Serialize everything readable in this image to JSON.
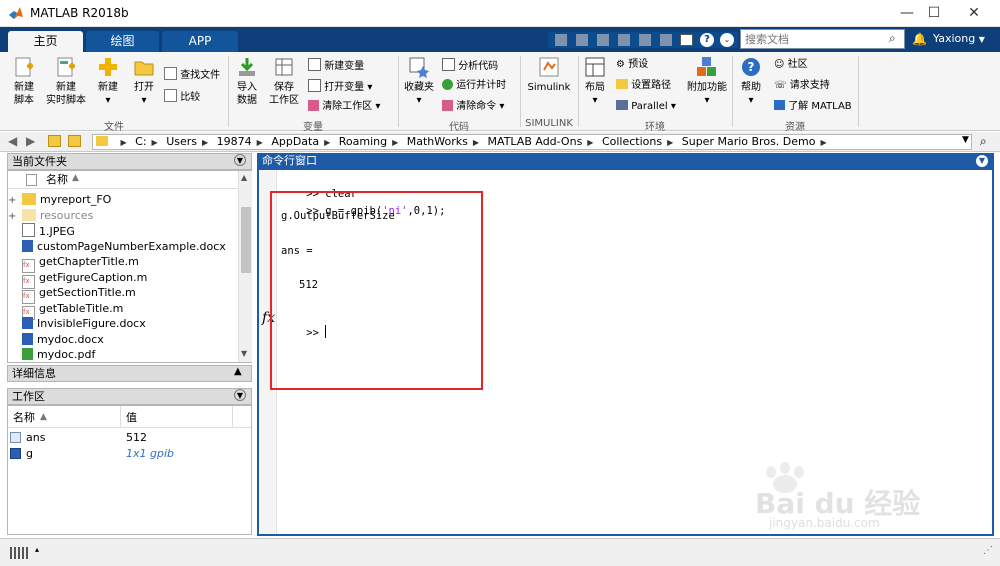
{
  "window": {
    "title": "MATLAB R2018b",
    "controls": [
      "—",
      "☐",
      "✕"
    ]
  },
  "tabs": [
    {
      "label": "主页"
    },
    {
      "label": "绘图"
    },
    {
      "label": "APP"
    }
  ],
  "search": {
    "placeholder": "搜索文档",
    "user": "Yaxiong"
  },
  "ribbon": {
    "file": {
      "new_script": [
        "新建",
        "脚本"
      ],
      "new_live_script": [
        "新建",
        "实时脚本"
      ],
      "new": "新建",
      "open": "打开",
      "find_files": "查找文件",
      "compare": "比较",
      "group_label": "文件"
    },
    "variable": {
      "import": [
        "导入",
        "数据"
      ],
      "save_ws": [
        "保存",
        "工作区"
      ],
      "new_var": "新建变量",
      "open_var": "打开变量",
      "clear_ws": "清除工作区",
      "group_label": "变量"
    },
    "code": {
      "favorites": "收藏夹",
      "analyze": "分析代码",
      "run_time": "运行并计时",
      "clear_cmds": "清除命令",
      "group_label": "代码"
    },
    "simulink": {
      "label": "Simulink",
      "group_label": "SIMULINK"
    },
    "environment": {
      "layout": "布局",
      "preferences": "预设",
      "set_path": "设置路径",
      "parallel": "Parallel",
      "addons": "附加功能",
      "group_label": "环境"
    },
    "resources": {
      "help": "帮助",
      "community": "社区",
      "request_support": "请求支持",
      "learn_matlab": "了解 MATLAB",
      "group_label": "资源"
    }
  },
  "path": [
    "C:",
    "Users",
    "19874",
    "AppData",
    "Roaming",
    "MathWorks",
    "MATLAB Add-Ons",
    "Collections",
    "Super Mario Bros. Demo"
  ],
  "current_folder": {
    "title": "当前文件夹",
    "name_col": "名称",
    "files": [
      {
        "name": "myreport_FO",
        "kind": "folder",
        "expand": "+"
      },
      {
        "name": "resources",
        "kind": "folder-gray",
        "expand": "+"
      },
      {
        "name": "1.JPEG",
        "kind": "file"
      },
      {
        "name": "customPageNumberExample.docx",
        "kind": "docx"
      },
      {
        "name": "getChapterTitle.m",
        "kind": "mfile"
      },
      {
        "name": "getFigureCaption.m",
        "kind": "mfile"
      },
      {
        "name": "getSectionTitle.m",
        "kind": "mfile"
      },
      {
        "name": "getTableTitle.m",
        "kind": "mfile"
      },
      {
        "name": "InvisibleFigure.docx",
        "kind": "docx"
      },
      {
        "name": "mydoc.docx",
        "kind": "docx"
      },
      {
        "name": "mydoc.pdf",
        "kind": "pdf"
      }
    ]
  },
  "details": {
    "title": "详细信息"
  },
  "workspace": {
    "title": "工作区",
    "name_col": "名称",
    "value_col": "值",
    "vars": [
      {
        "name": "ans",
        "value": "512"
      },
      {
        "name": "g",
        "value": "1x1 gpib"
      }
    ]
  },
  "command_window": {
    "title": "命令行窗口",
    "lines": [
      {
        "prompt": ">>",
        "code": "clear"
      },
      {
        "prompt": ">>",
        "code_pre": "g = gpib(",
        "code_str": "'ni'",
        "code_post": ",0,1);"
      },
      {
        "code": "g.OutputBufferSize"
      },
      {
        "code": "ans ="
      },
      {
        "code": "512"
      }
    ],
    "fx": "fx",
    "final_prompt": ">>"
  },
  "colors": {
    "tab_bar": "#0e3f79",
    "cmd_header": "#1f5aa6",
    "highlight_box": "#e8252a",
    "string_purple": "#a020f0"
  },
  "watermark": {
    "brand": "Bai du 经验",
    "url": "jingyan.baidu.com"
  }
}
